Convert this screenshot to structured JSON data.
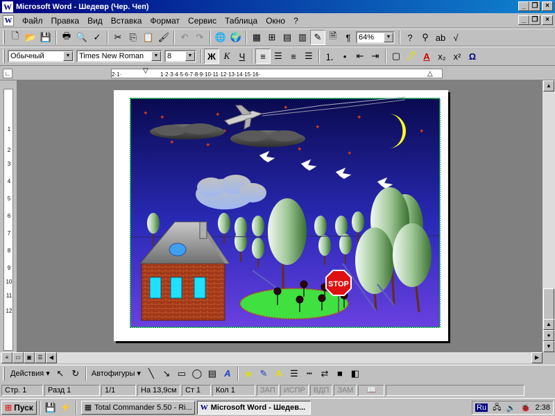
{
  "window": {
    "title": "Microsoft Word - Шедевр (Чер. Чеп)",
    "app_icon": "W"
  },
  "menu": [
    "Файл",
    "Правка",
    "Вид",
    "Вставка",
    "Формат",
    "Сервис",
    "Таблица",
    "Окно",
    "?"
  ],
  "toolbar_standard": {
    "zoom": "64%"
  },
  "toolbar_format": {
    "style": "Обычный",
    "font": "Times New Roman",
    "size": "8",
    "bold": "Ж",
    "italic": "К",
    "underline": "Ч"
  },
  "drawbar": {
    "actions": "Действия",
    "autoshapes": "Автофигуры"
  },
  "statusbar": {
    "page": "Стр. 1",
    "section": "Разд 1",
    "pages": "1/1",
    "at": "На 13,9см",
    "line": "Ст 1",
    "col": "Кол 1",
    "rec": "ЗАП",
    "trk": "ИСПР",
    "ext": "ВДП",
    "ovr": "ЗАМ"
  },
  "taskbar": {
    "start": "Пуск",
    "tasks": [
      "Total Commander 5.50 - Ri...",
      "Microsoft Word - Шедев..."
    ],
    "lang": "Ru",
    "clock": "2:38"
  },
  "drawing": {
    "sign_text": "STOP"
  },
  "colors": {
    "titlebar": "#000080",
    "sky_top": "#0a0a60",
    "sky_bottom": "#5040e0",
    "lawn": "#40e040",
    "brick": "#a03818"
  }
}
